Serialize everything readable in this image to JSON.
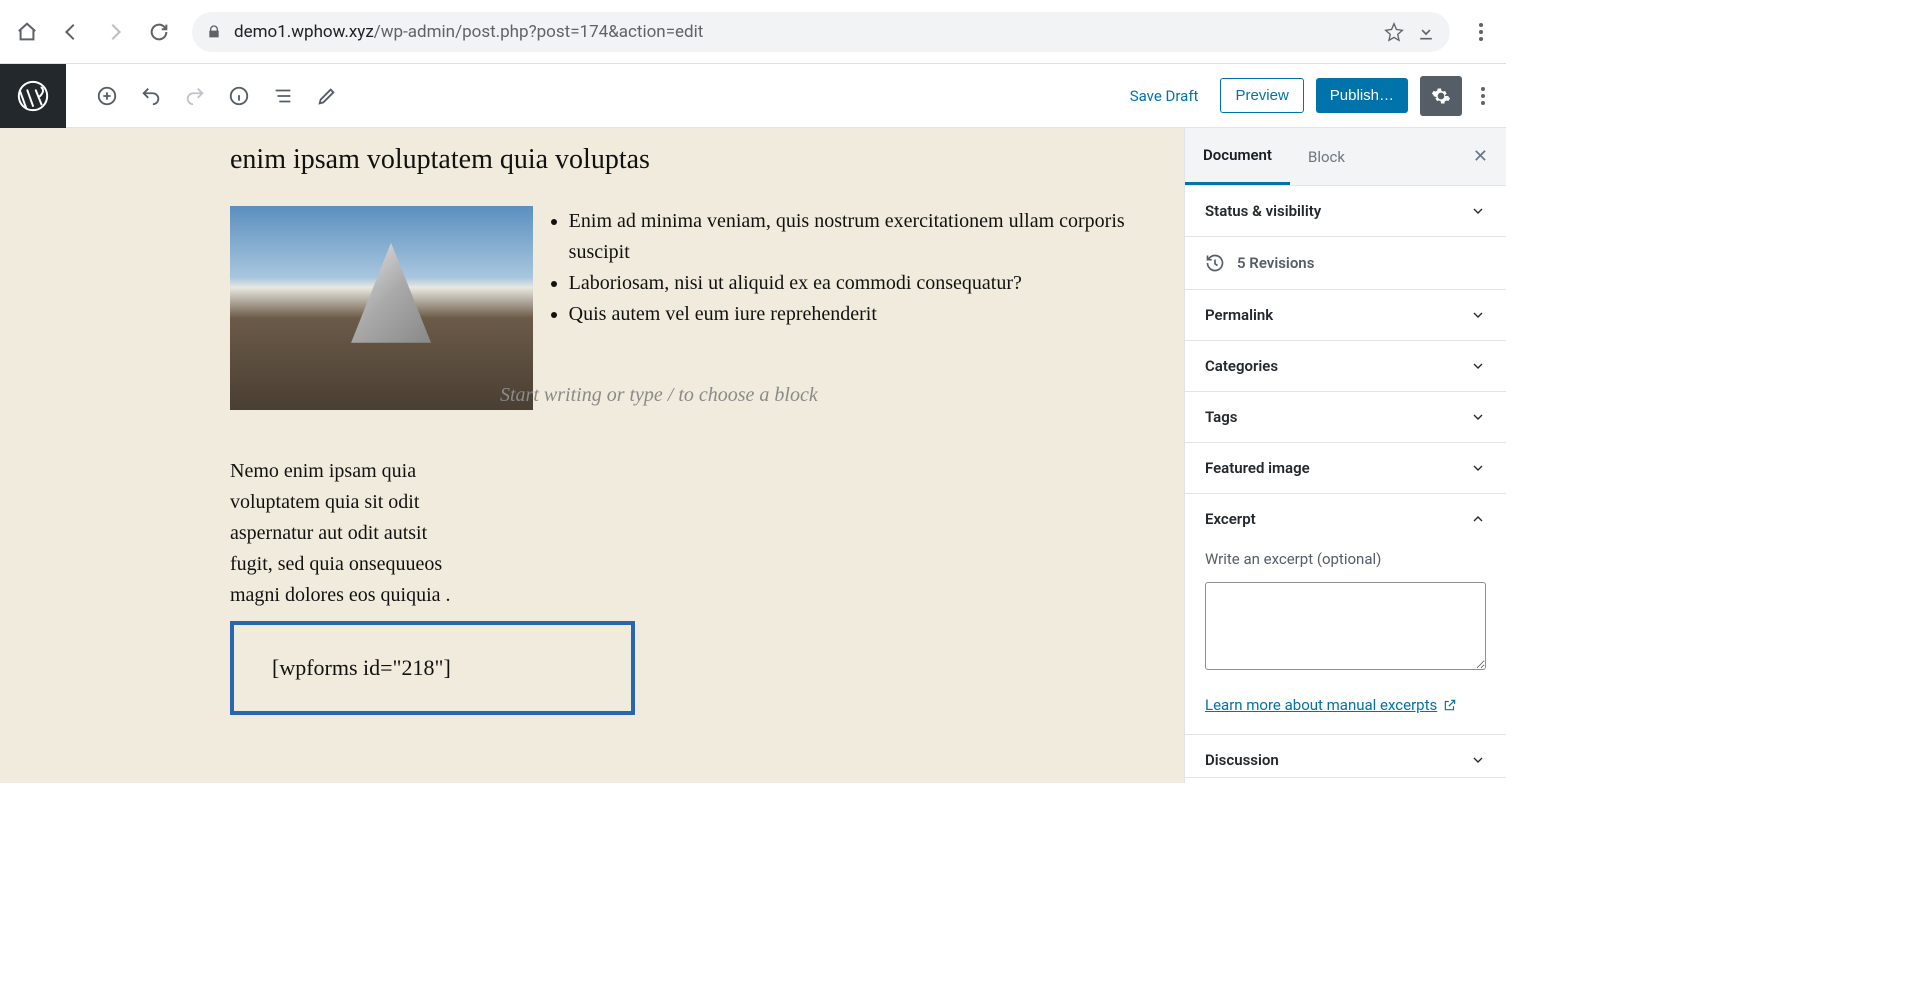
{
  "browser": {
    "url_host": "demo1.wphow.xyz",
    "url_path": "/wp-admin/post.php?post=174&action=edit"
  },
  "toolbar": {
    "save_draft": "Save Draft",
    "preview": "Preview",
    "publish": "Publish…"
  },
  "editor": {
    "heading": "enim ipsam voluptatem quia voluptas",
    "bullets": [
      "Enim ad minima veniam, quis nostrum exercitationem ullam corporis suscipit",
      "Laboriosam, nisi ut aliquid ex ea commodi consequatur?",
      "Quis autem vel eum iure reprehenderit"
    ],
    "placeholder": "Start writing or type / to choose a block",
    "paragraph": "Nemo enim ipsam quia voluptatem quia sit odit aspernatur aut odit autsit fugit, sed quia onsequueos magni dolores eos quiquia .",
    "shortcode": "[wpforms id=\"218\"]"
  },
  "sidebar": {
    "tabs": {
      "document": "Document",
      "block": "Block"
    },
    "panels": {
      "status": "Status & visibility",
      "revisions": "5 Revisions",
      "permalink": "Permalink",
      "categories": "Categories",
      "tags": "Tags",
      "featured": "Featured image",
      "excerpt": "Excerpt",
      "excerpt_label": "Write an excerpt (optional)",
      "excerpt_link": "Learn more about manual excerpts",
      "discussion": "Discussion"
    }
  }
}
